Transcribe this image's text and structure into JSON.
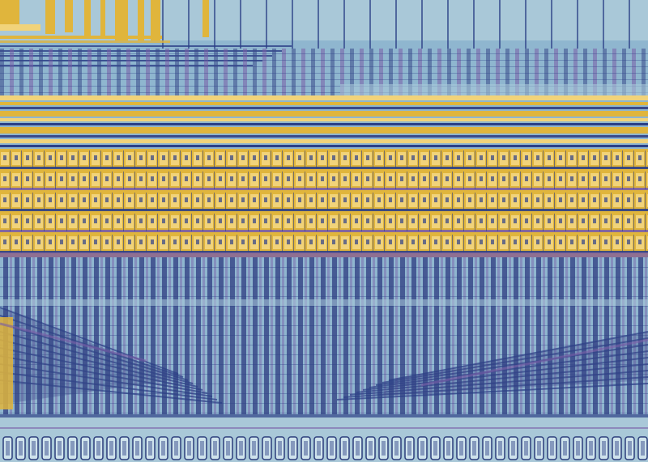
{
  "image": {
    "subject": "die-micrograph",
    "palette": {
      "substrate": "#8fb6cf",
      "substrate_light": "#a9c8d8",
      "metal_gold": "#e0b53c",
      "metal_gold_light": "#f1d37a",
      "metal_dark": "#3a4a8a",
      "via_purple": "#7a5fa8",
      "trace_blue": "#2b3f86",
      "pad_fill": "#cfe3ec",
      "pad_edge": "#2a3c7a"
    },
    "regions": [
      {
        "name": "top-routing-block",
        "material": "metal_gold"
      },
      {
        "name": "upper-column-array",
        "material": "substrate"
      },
      {
        "name": "horizontal-bus",
        "material": "metal_gold"
      },
      {
        "name": "cell-array",
        "material": "metal_gold"
      },
      {
        "name": "lower-column-array",
        "material": "substrate"
      },
      {
        "name": "diagonal-fan-left",
        "material": "metal_dark"
      },
      {
        "name": "diagonal-fan-right",
        "material": "metal_dark"
      },
      {
        "name": "pad-row",
        "material": "pad_fill"
      }
    ]
  }
}
